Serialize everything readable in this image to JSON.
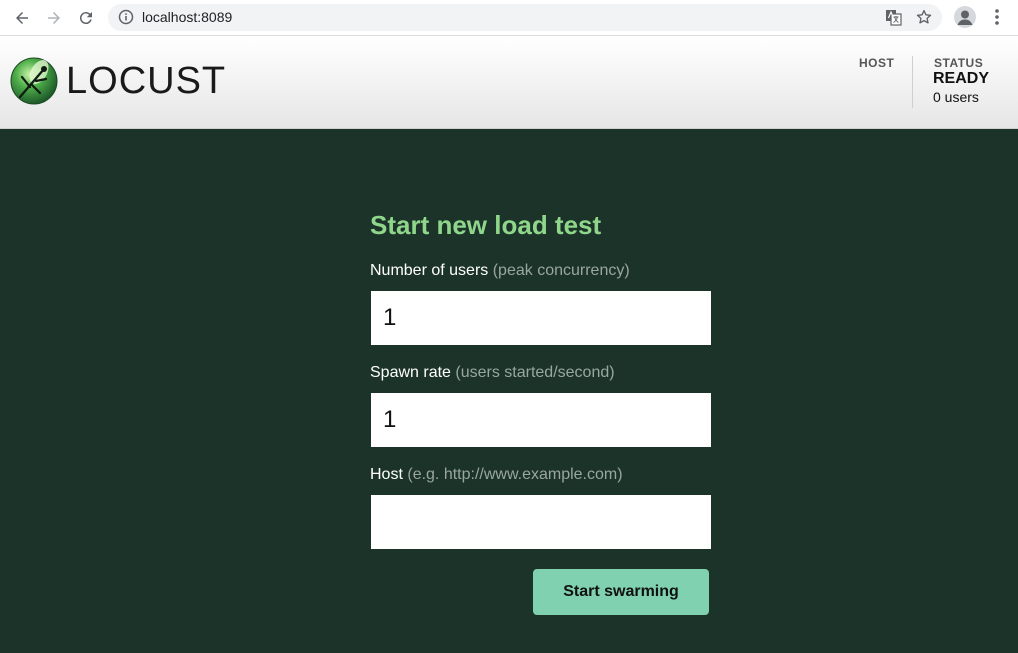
{
  "browser": {
    "url": "localhost:8089"
  },
  "header": {
    "logo_text": "LOCUST",
    "host_label": "HOST",
    "status_label": "STATUS",
    "status_value": "READY",
    "users_count": "0 users"
  },
  "form": {
    "title": "Start new load test",
    "users": {
      "label": "Number of users",
      "hint": "(peak concurrency)",
      "value": "1"
    },
    "spawn_rate": {
      "label": "Spawn rate",
      "hint": "(users started/second)",
      "value": "1"
    },
    "host": {
      "label": "Host",
      "hint": "(e.g. http://www.example.com)",
      "value": ""
    },
    "submit_label": "Start swarming"
  },
  "colors": {
    "background": "#1b3329",
    "title": "#8fd68b",
    "button": "#7fd1b0"
  }
}
